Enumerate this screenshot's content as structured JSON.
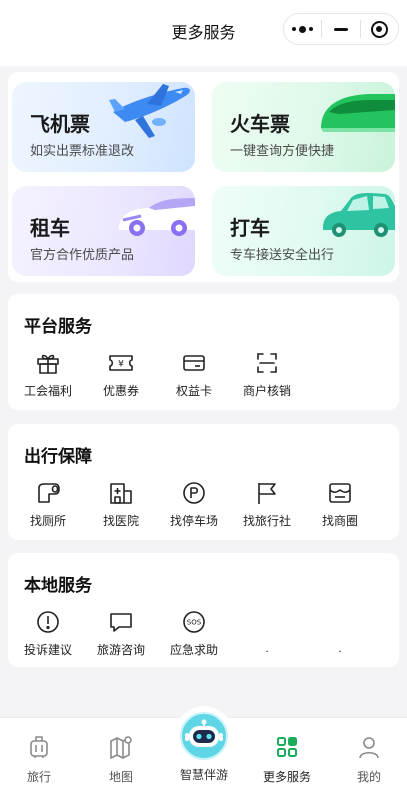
{
  "header": {
    "title": "更多服务"
  },
  "capsule": {
    "more_icon": "more-dots-icon",
    "minimize_icon": "minimize-icon",
    "close_icon": "target-icon"
  },
  "tiles": [
    {
      "title": "飞机票",
      "subtitle": "如实出票标准退改",
      "art": "airplane"
    },
    {
      "title": "火车票",
      "subtitle": "一键查询方便快捷",
      "art": "train"
    },
    {
      "title": "租车",
      "subtitle": "官方合作优质产品",
      "art": "rental-car"
    },
    {
      "title": "打车",
      "subtitle": "专车接送安全出行",
      "art": "taxi"
    }
  ],
  "platform": {
    "title": "平台服务",
    "items": [
      {
        "label": "工会福利",
        "icon": "gift-icon"
      },
      {
        "label": "优惠券",
        "icon": "coupon-icon"
      },
      {
        "label": "权益卡",
        "icon": "card-icon"
      },
      {
        "label": "商户核销",
        "icon": "scan-icon"
      }
    ]
  },
  "travel": {
    "title": "出行保障",
    "items": [
      {
        "label": "找厕所",
        "icon": "toilet-icon"
      },
      {
        "label": "找医院",
        "icon": "hospital-icon"
      },
      {
        "label": "找停车场",
        "icon": "parking-icon"
      },
      {
        "label": "找旅行社",
        "icon": "flag-icon"
      },
      {
        "label": "找商圈",
        "icon": "shop-icon"
      }
    ]
  },
  "local": {
    "title": "本地服务",
    "items": [
      {
        "label": "投诉建议",
        "icon": "alert-icon"
      },
      {
        "label": "旅游咨询",
        "icon": "chat-icon"
      },
      {
        "label": "应急求助",
        "icon": "sos-icon"
      },
      {
        "label": ".",
        "icon": ""
      },
      {
        "label": ".",
        "icon": ""
      }
    ]
  },
  "tabbar": {
    "active": "更多服务",
    "accent": "#1aad5a",
    "items": [
      {
        "label": "旅行",
        "icon": "suitcase-icon"
      },
      {
        "label": "地图",
        "icon": "map-icon"
      },
      {
        "label": "智慧伴游",
        "icon": "robot-icon"
      },
      {
        "label": "更多服务",
        "icon": "grid-icon"
      },
      {
        "label": "我的",
        "icon": "user-icon"
      }
    ]
  }
}
